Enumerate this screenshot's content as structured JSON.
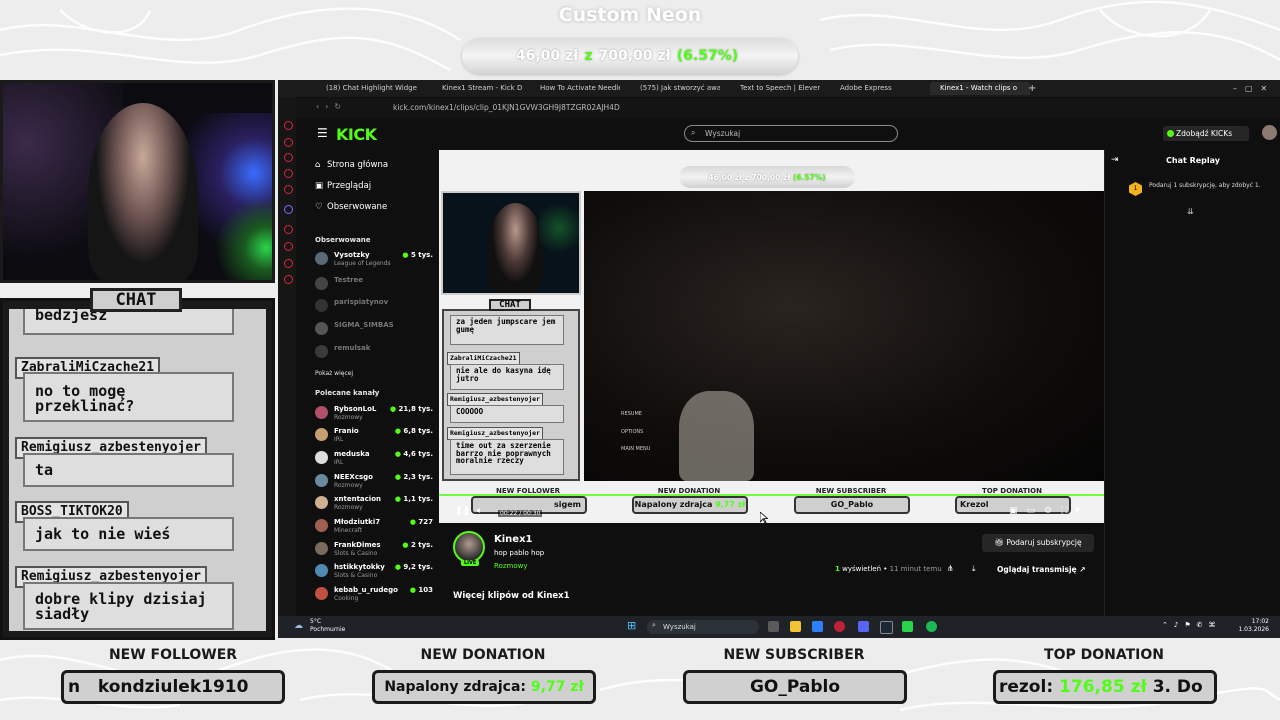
{
  "overlay": {
    "goal_title": "Custom Neon",
    "goal_current": "46,00 zł",
    "goal_sep": "z",
    "goal_target": "700,00 zł",
    "goal_percent": "(6.57%)",
    "chat_tag": "CHAT",
    "chat": [
      {
        "name": "",
        "msg": "bedzjesz"
      },
      {
        "name": "ZabraliMiCzache21",
        "msg": "no to mogę przeklinać?"
      },
      {
        "name": "Remigiusz_azbestenyojer",
        "msg": "ta"
      },
      {
        "name": "BOSS_TIKTOK20",
        "msg": "jak to nie wieś"
      },
      {
        "name": "Remigiusz_azbestenyojer",
        "msg": "dobre klipy dzisiaj siadły"
      }
    ],
    "bottom": [
      {
        "label": "NEW FOLLOWER",
        "value": "n   kondziulek1910",
        "amount": ""
      },
      {
        "label": "NEW DONATION",
        "value": "Napalony zdrajca:",
        "amount": "9,77 zł"
      },
      {
        "label": "NEW SUBSCRIBER",
        "value": "GO_Pablo",
        "amount": ""
      },
      {
        "label": "TOP DONATION",
        "value": "rezol:",
        "amount": "176,85 zł",
        "suffix": "3. Do"
      }
    ]
  },
  "browser": {
    "tabs": [
      {
        "label": "(18) Chat Highlight Widge"
      },
      {
        "label": "Kinex1 Stream - Kick Da"
      },
      {
        "label": "How To Activate Needle"
      },
      {
        "label": "(575) Jak stworzyć awat"
      },
      {
        "label": "Text to Speech | ElevenL"
      },
      {
        "label": "Adobe Express"
      },
      {
        "label": "Kinex1 - Watch clips o"
      }
    ],
    "url": "kick.com/kinex1/clips/clip_01KJN1GVW3GH9J8TZGR02AJH4D",
    "logo": "KICK",
    "search_placeholder": "Wyszukaj",
    "get_kicks": "Zdobądź KICKs",
    "nav": [
      {
        "label": "Strona główna",
        "icon": "home-icon"
      },
      {
        "label": "Przeglądaj",
        "icon": "browse-icon"
      },
      {
        "label": "Obserwowane",
        "icon": "heart-icon"
      }
    ],
    "followed_title": "Obserwowane",
    "followed": [
      {
        "name": "Vysotzky",
        "cat": "League of Legends",
        "viewers": "5 tys.",
        "online": true
      },
      {
        "name": "Testree",
        "cat": "",
        "viewers": "",
        "online": false
      },
      {
        "name": "parispiatynov",
        "cat": "",
        "viewers": "",
        "online": false
      },
      {
        "name": "SIGMA_SIMBAS",
        "cat": "",
        "viewers": "",
        "online": false
      },
      {
        "name": "remulsak",
        "cat": "",
        "viewers": "",
        "online": false
      }
    ],
    "show_more": "Pokaż więcej",
    "recommended_title": "Polecane kanały",
    "recommended": [
      {
        "name": "RybsonLoL",
        "cat": "Rozmowy",
        "viewers": "21,8 tys."
      },
      {
        "name": "Franio",
        "cat": "IRL",
        "viewers": "6,8 tys."
      },
      {
        "name": "meduska",
        "cat": "IRL",
        "viewers": "4,6 tys."
      },
      {
        "name": "NEEXcsgo",
        "cat": "Rozmowy",
        "viewers": "2,3 tys."
      },
      {
        "name": "xntentacion",
        "cat": "Rozmowy",
        "viewers": "1,1 tys."
      },
      {
        "name": "Młodziutki7",
        "cat": "Minecraft",
        "viewers": "727"
      },
      {
        "name": "FrankDimes",
        "cat": "Slots & Casino",
        "viewers": "2 tys."
      },
      {
        "name": "hstikkytokky",
        "cat": "Slots & Casino",
        "viewers": "9,2 tys."
      },
      {
        "name": "kebab_u_rudego",
        "cat": "Cooking",
        "viewers": "103"
      }
    ],
    "player": {
      "goal": "46,00 zł z 700,00 zł",
      "goal_percent": "(6.57%)",
      "menu": [
        "RESUME",
        "OPTIONS",
        "MAIN MENU"
      ],
      "chat_tag": "CHAT",
      "chat": [
        {
          "name": "",
          "msg": "za jeden jumpscare jem gumę"
        },
        {
          "name": "ZabraliMiCzache21",
          "msg": "nie ale do kasyna idę jutro"
        },
        {
          "name": "Remigiusz_azbestenyojer",
          "msg": "COOOOO"
        },
        {
          "name": "Remigiusz_azbestenyojer",
          "msg": "time out za szerzenie barrzo nie poprawnych moralnie rzeczy"
        }
      ],
      "labels": [
        "NEW FOLLOWER",
        "NEW DONATION",
        "NEW SUBSCRIBER",
        "TOP DONATION"
      ],
      "boxes": [
        "sigem",
        "Napalony zdrajca",
        "GO_Pablo",
        "Krezol"
      ],
      "donation_amount": "9,77 zł",
      "time": "00:22 / 00:30"
    },
    "streamer": "Kinex1",
    "stream_title": "hop pablo hop",
    "category": "Rozmowy",
    "live": "LIVE",
    "gift_sub": "Podaruj subskrypcję",
    "views_count": "1",
    "views_label": "wyświetleń",
    "views_time": "11 minut temu",
    "watch_stream": "Oglądaj transmisję",
    "more_clips": "Więcej klipów od Kinex1",
    "replay_title": "Chat Replay",
    "replay_msg": "Podaruj 1 subskrypcję, aby zdobyć 1.",
    "replay_badge": "1"
  },
  "taskbar": {
    "weather_temp": "5°C",
    "weather_desc": "Pochmurnie",
    "search": "Wyszukaj",
    "time": "17:02",
    "date": "1.03.2026"
  },
  "colors": {
    "accent": "#53fc18",
    "background": "#0f0f10"
  }
}
